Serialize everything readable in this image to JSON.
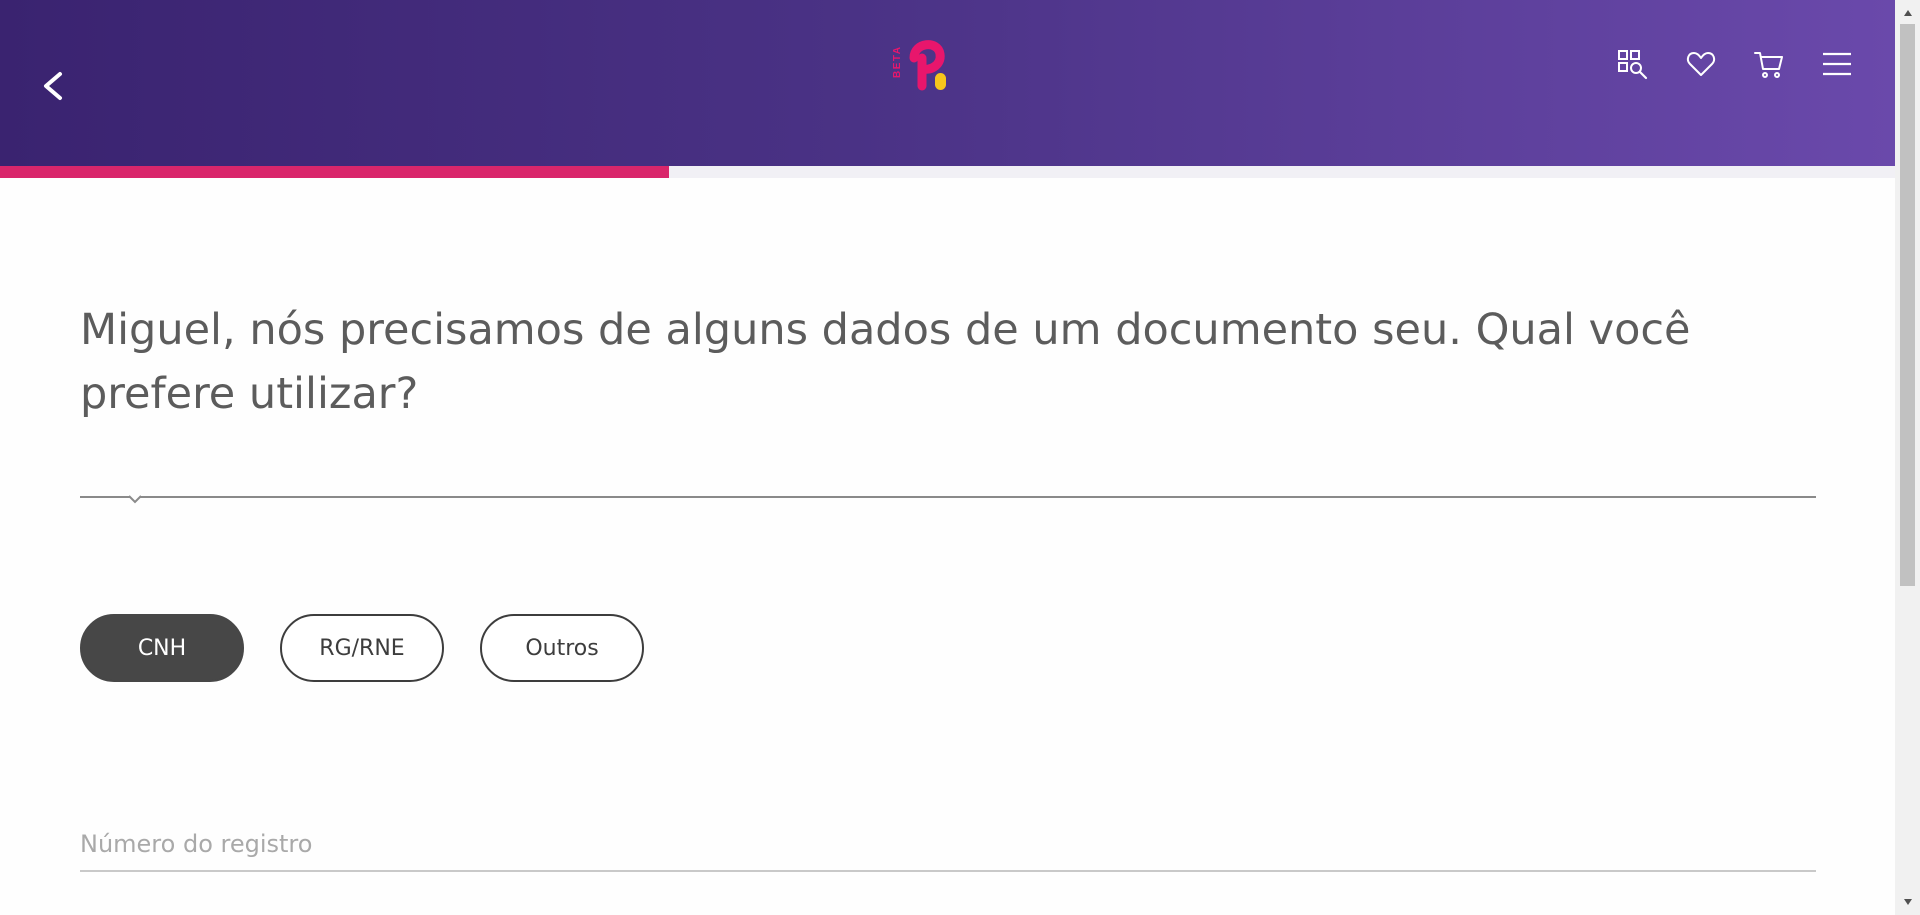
{
  "header": {
    "back_icon": "chevron-left-icon",
    "logo": {
      "badge_text": "BETA",
      "brand_color": "#e8166c",
      "accent_color": "#f7c51b"
    },
    "icons": [
      "catalog-search-icon",
      "heart-icon",
      "cart-icon",
      "menu-icon"
    ]
  },
  "progress": {
    "fraction": 0.353,
    "color": "#d9266b"
  },
  "main": {
    "question": "Miguel, nós precisamos de alguns dados de um documento seu. Qual você prefere utilizar?",
    "options": [
      {
        "label": "CNH",
        "selected": true
      },
      {
        "label": "RG/RNE",
        "selected": false
      },
      {
        "label": "Outros",
        "selected": false
      }
    ],
    "registration_field": {
      "placeholder": "Número do registro",
      "value": ""
    }
  },
  "colors": {
    "header_start": "#3a2370",
    "header_end": "#6a49ab",
    "text": "#5c5c5c",
    "pill_selected": "#474747"
  }
}
